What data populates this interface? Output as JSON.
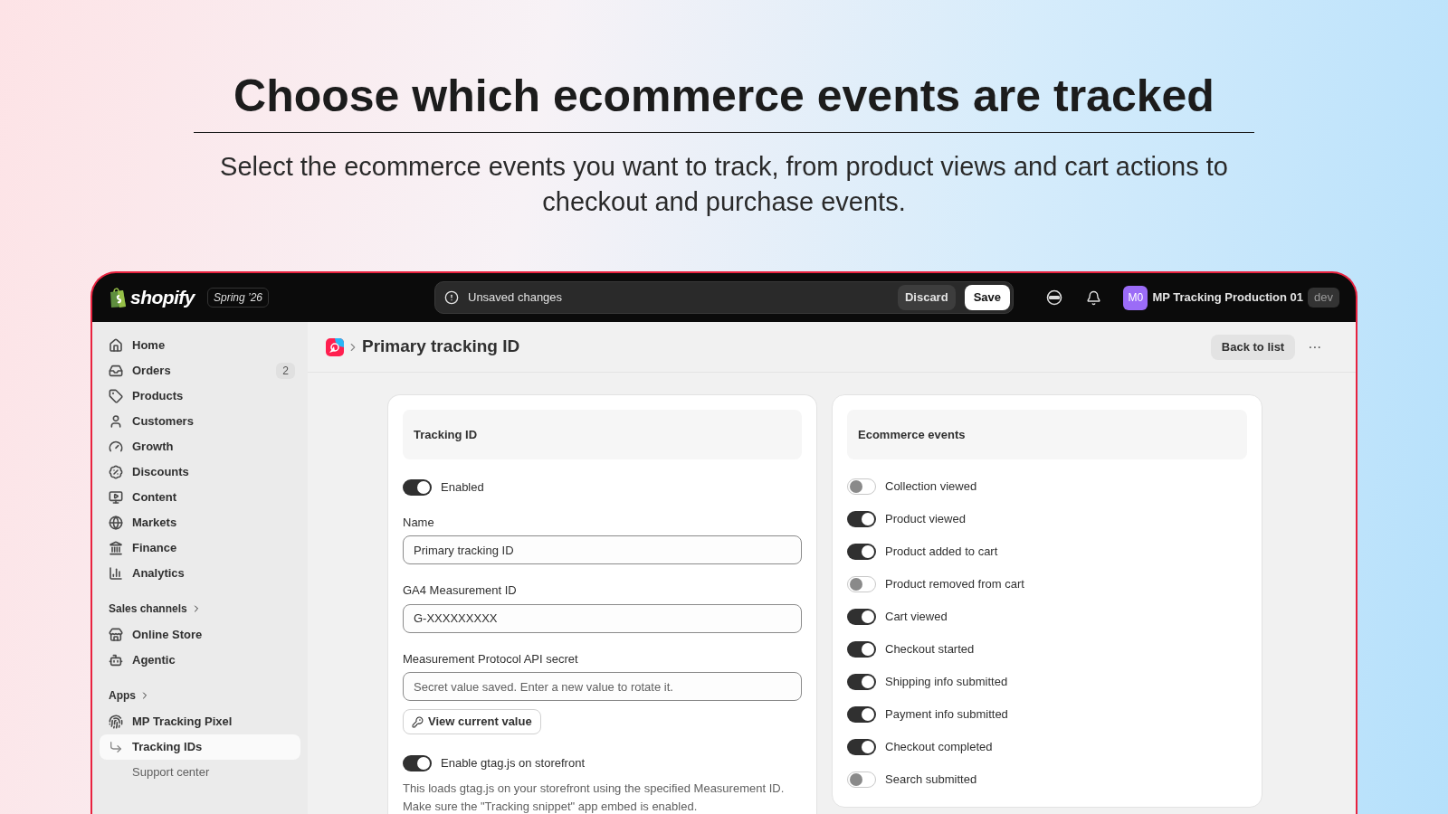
{
  "hero": {
    "title": "Choose which ecommerce events are tracked",
    "subtitle": "Select the ecommerce events you want to track, from product views and cart actions to checkout and purchase events."
  },
  "topbar": {
    "brand": "shopify",
    "edition": "Spring ’26",
    "notice": "Unsaved changes",
    "discard": "Discard",
    "save": "Save",
    "avatar": "M0",
    "store": "MP Tracking Production 01",
    "env": "dev"
  },
  "sidebar": {
    "items": [
      {
        "label": "Home",
        "selected": false
      },
      {
        "label": "Orders",
        "badge": "2",
        "selected": false
      },
      {
        "label": "Products",
        "selected": false
      },
      {
        "label": "Customers",
        "selected": false
      },
      {
        "label": "Growth",
        "selected": false
      },
      {
        "label": "Discounts",
        "selected": false
      },
      {
        "label": "Content",
        "selected": false
      },
      {
        "label": "Markets",
        "selected": false
      },
      {
        "label": "Finance",
        "selected": false
      },
      {
        "label": "Analytics",
        "selected": false
      }
    ],
    "sales_channels": {
      "heading": "Sales channels",
      "items": [
        {
          "label": "Online Store",
          "selected": false
        },
        {
          "label": "Agentic",
          "selected": false
        }
      ]
    },
    "apps": {
      "heading": "Apps",
      "items": [
        {
          "label": "MP Tracking Pixel",
          "selected": false,
          "children": [
            {
              "label": "Tracking IDs",
              "selected": true
            },
            {
              "label": "Support center",
              "selected": false
            }
          ]
        }
      ]
    }
  },
  "page": {
    "breadcrumb_title": "Primary tracking ID",
    "back": "Back to list",
    "more": "···"
  },
  "tracking_card": {
    "title": "Tracking ID",
    "enabled": {
      "label": "Enabled",
      "on": true
    },
    "fields": [
      {
        "label": "Name",
        "value": "Primary tracking ID"
      },
      {
        "label": "GA4 Measurement ID",
        "value": "G-XXXXXXXXX"
      },
      {
        "label": "Measurement Protocol API secret",
        "placeholder": "Secret value saved. Enter a new value to rotate it."
      }
    ],
    "view_button": "View current value",
    "gtag": {
      "label": "Enable gtag.js on storefront",
      "on": true
    },
    "help": "This loads gtag.js on your storefront using the specified Measurement ID. Make sure the \"Tracking snippet\" app embed is enabled."
  },
  "events_card": {
    "title": "Ecommerce events",
    "events": [
      {
        "label": "Collection viewed",
        "on": false
      },
      {
        "label": "Product viewed",
        "on": true
      },
      {
        "label": "Product added to cart",
        "on": true
      },
      {
        "label": "Product removed from cart",
        "on": false
      },
      {
        "label": "Cart viewed",
        "on": true
      },
      {
        "label": "Checkout started",
        "on": true
      },
      {
        "label": "Shipping info submitted",
        "on": true
      },
      {
        "label": "Payment info submitted",
        "on": true
      },
      {
        "label": "Checkout completed",
        "on": true
      },
      {
        "label": "Search submitted",
        "on": false
      }
    ]
  }
}
